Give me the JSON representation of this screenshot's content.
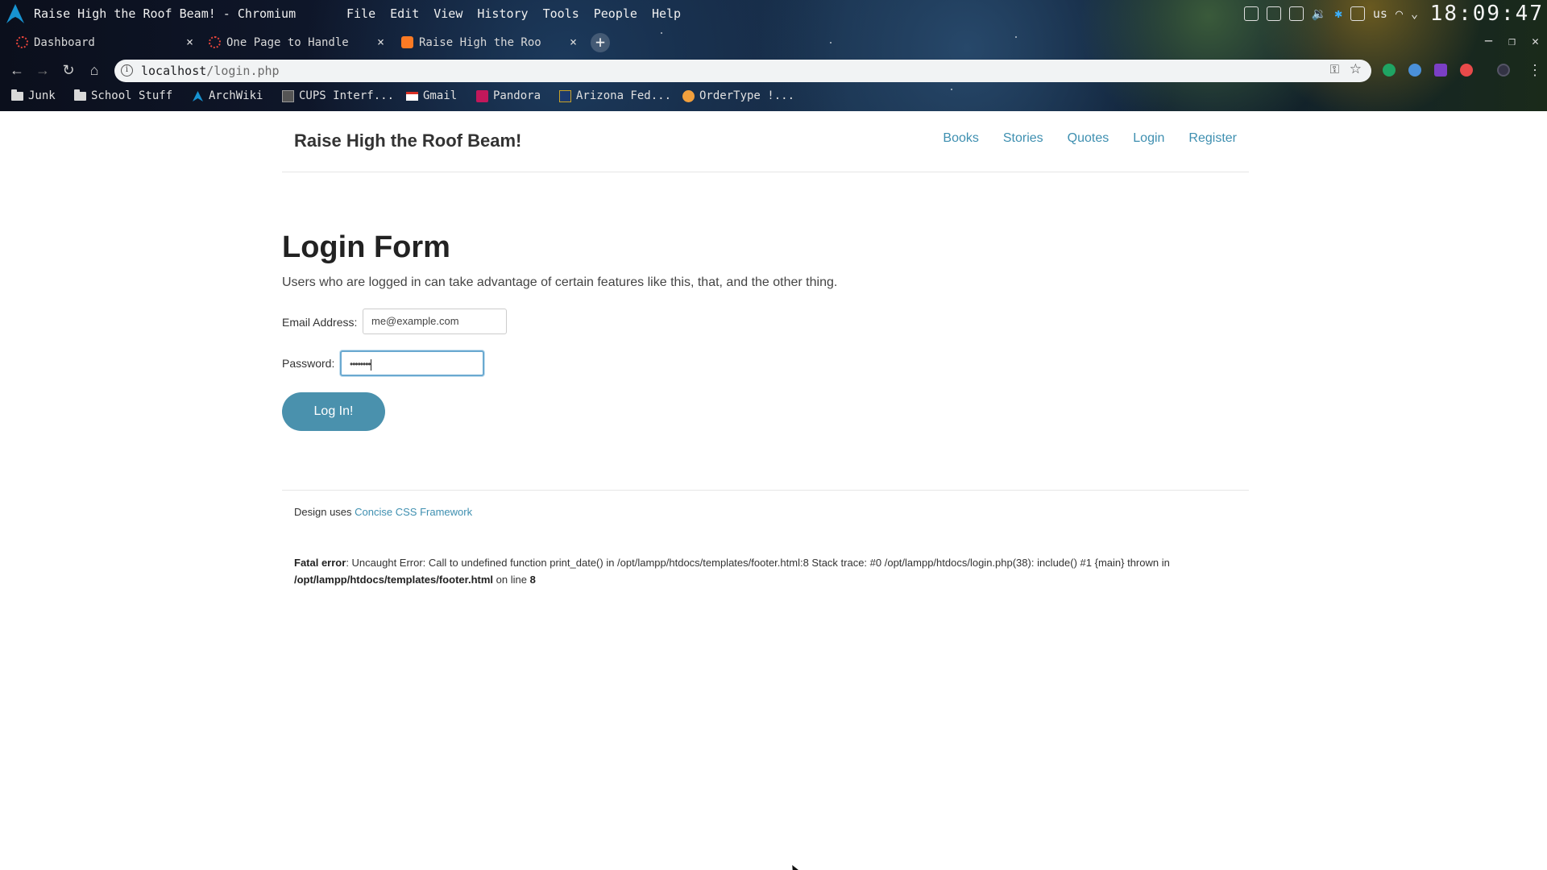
{
  "window": {
    "title": "Raise High the Roof Beam! - Chromium",
    "menu": [
      "File",
      "Edit",
      "View",
      "History",
      "Tools",
      "People",
      "Help"
    ],
    "tray_lang": "us",
    "clock": "18:09:47"
  },
  "tabs": [
    {
      "label": "Dashboard",
      "close": "×"
    },
    {
      "label": "One Page to Handle",
      "close": "×"
    },
    {
      "label": "Raise High the Roo",
      "close": "×"
    }
  ],
  "new_tab": "+",
  "address_bar": {
    "host": "localhost",
    "path": "/login.php"
  },
  "bookmarks": [
    "Junk",
    "School Stuff",
    "ArchWiki",
    "CUPS Interf...",
    "Gmail",
    "Pandora",
    "Arizona Fed...",
    "OrderType !..."
  ],
  "site": {
    "title": "Raise High the Roof Beam!",
    "nav": [
      "Books",
      "Stories",
      "Quotes",
      "Login",
      "Register"
    ]
  },
  "login": {
    "heading": "Login Form",
    "intro": "Users who are logged in can take advantage of certain features like this, that, and the other thing.",
    "email_label": "Email Address:",
    "email_value": "me@example.com",
    "password_label": "Password:",
    "password_value": "••••••••",
    "submit": "Log In!"
  },
  "footer": {
    "design_prefix": "Design uses",
    "design_link": "Concise CSS Framework",
    "error_label": "Fatal error",
    "error_text": ": Uncaught Error: Call to undefined function print_date() in /opt/lampp/htdocs/templates/footer.html:8 Stack trace: #0 /opt/lampp/htdocs/login.php(38): include() #1 {main} thrown in",
    "error_file": "/opt/lampp/htdocs/templates/footer.html",
    "error_on_line": "on line",
    "error_line": "8"
  },
  "colors": {
    "link": "#3e8fb0",
    "button": "#4a91ad",
    "focus_border": "#6aa9d0"
  }
}
